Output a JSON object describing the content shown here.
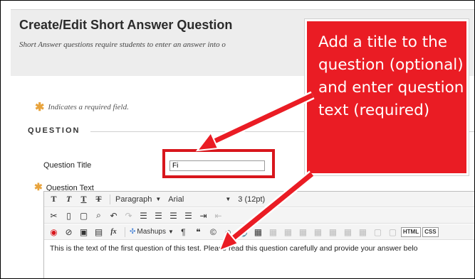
{
  "header": {
    "title": "Create/Edit Short Answer Question",
    "subtitle": "Short Answer questions require students to enter an answer into o"
  },
  "required_note": {
    "star": "✱",
    "text": "Indicates a required field."
  },
  "section": {
    "heading": "QUESTION"
  },
  "question_title": {
    "label": "Question Title",
    "value": "Fi"
  },
  "question_text": {
    "star": "✱",
    "label": "Question Text",
    "body": "This is the text of the first question of this test. Please read this question carefully and provide your answer belo"
  },
  "toolbar": {
    "row1": {
      "bold": "T",
      "italic": "T",
      "underline": "T",
      "strike": "T",
      "paragraph": "Paragraph",
      "font": "Arial",
      "size": "3 (12pt)"
    },
    "row3": {
      "mashups": "Mashups",
      "html": "HTML",
      "css": "CSS"
    }
  },
  "callout": {
    "text": "Add a title to the question (optional) and enter question text (required)"
  },
  "colors": {
    "callout_red": "#ea1c24",
    "required_star": "#e8a33c",
    "header_bg": "#ededed"
  }
}
